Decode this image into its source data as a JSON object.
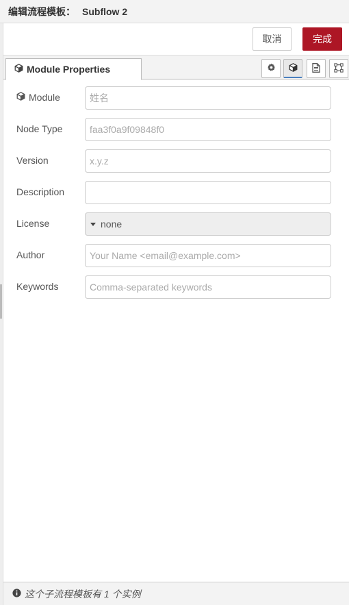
{
  "header": {
    "title": "编辑流程模板：",
    "subflow_name": "Subflow 2"
  },
  "toolbar": {
    "cancel_label": "取消",
    "done_label": "完成"
  },
  "tabs": {
    "active_label": "Module Properties",
    "icons": [
      "settings-icon",
      "module-icon",
      "description-icon",
      "appearance-icon"
    ]
  },
  "form": {
    "module": {
      "label": "Module",
      "value": "",
      "placeholder": "姓名"
    },
    "node_type": {
      "label": "Node Type",
      "value": "",
      "placeholder": "faa3f0a9f09848f0"
    },
    "version": {
      "label": "Version",
      "value": "",
      "placeholder": "x.y.z"
    },
    "description": {
      "label": "Description",
      "value": "",
      "placeholder": ""
    },
    "license": {
      "label": "License",
      "value": "none"
    },
    "author": {
      "label": "Author",
      "value": "",
      "placeholder": "Your Name <email@example.com>"
    },
    "keywords": {
      "label": "Keywords",
      "value": "",
      "placeholder": "Comma-separated keywords"
    }
  },
  "footer": {
    "text": "这个子流程模板有 1 个实例"
  },
  "colors": {
    "accent": "#ad1625",
    "selected_tab_underline": "#4a7fbf"
  }
}
